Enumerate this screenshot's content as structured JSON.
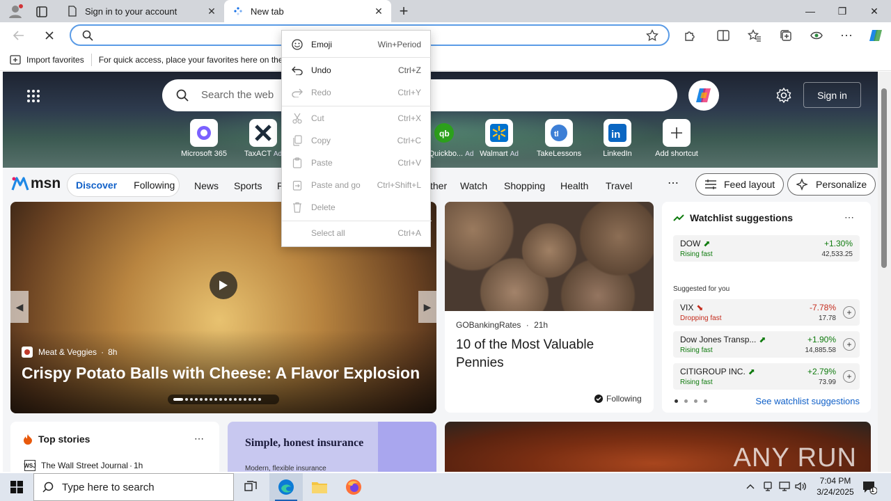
{
  "browser": {
    "tabs": [
      {
        "title": "Sign in to your account",
        "active": false
      },
      {
        "title": "New tab",
        "active": true
      }
    ],
    "address_bar": {
      "value": "",
      "placeholder": ""
    },
    "favorites_bar": {
      "import_label": "Import favorites",
      "hint": "For quick access, place your favorites here on the f"
    },
    "colors": {
      "accent": "#1060c8",
      "address_border": "#5a9be6"
    }
  },
  "newtab": {
    "search_placeholder": "Search the web",
    "sign_in": "Sign in",
    "shortcuts": [
      {
        "label": "Microsoft 365",
        "ad": ""
      },
      {
        "label": "TaxACT",
        "ad": "Ad"
      },
      {
        "label": "Quickbo...",
        "ad": "Ad"
      },
      {
        "label": "Walmart",
        "ad": "Ad"
      },
      {
        "label": "TakeLessons",
        "ad": ""
      },
      {
        "label": "LinkedIn",
        "ad": ""
      },
      {
        "label": "Add shortcut",
        "ad": ""
      }
    ],
    "brand": "msn",
    "feed_tabs": [
      "Discover",
      "Following"
    ],
    "nav_items": [
      "News",
      "Sports",
      "Pl",
      "ther",
      "Watch",
      "Shopping",
      "Health",
      "Travel"
    ],
    "feed_layout": "Feed layout",
    "personalize": "Personalize",
    "feature": {
      "source": "Meat & Veggies",
      "age": "8h",
      "title": "Crispy Potato Balls with Cheese: A Flavor Explosion"
    },
    "story2": {
      "source": "GOBankingRates",
      "age": "21h",
      "title": "10 of the Most Valuable Pennies",
      "following": "Following"
    },
    "watchlist": {
      "title": "Watchlist suggestions",
      "suggested_label": "Suggested for you",
      "see_all": "See watchlist suggestions",
      "items": [
        {
          "name": "DOW",
          "status": "Rising fast",
          "change": "+1.30%",
          "value": "42,533.25",
          "trend": "up"
        },
        {
          "name": "VIX",
          "status": "Dropping fast",
          "change": "-7.78%",
          "value": "17.78",
          "trend": "down"
        },
        {
          "name": "Dow Jones Transp...",
          "status": "Rising fast",
          "change": "+1.90%",
          "value": "14,885.58",
          "trend": "up"
        },
        {
          "name": "CITIGROUP INC.",
          "status": "Rising fast",
          "change": "+2.79%",
          "value": "73.99",
          "trend": "up"
        }
      ]
    },
    "top_stories": {
      "title": "Top stories",
      "first_source": "The Wall Street Journal",
      "first_age": "1h"
    },
    "ad_insurance": {
      "headline": "Simple, honest insurance",
      "sub": "Modern, flexible insurance"
    },
    "watermark": "ANY RUN"
  },
  "context_menu": {
    "items": [
      {
        "label": "Emoji",
        "shortcut": "Win+Period",
        "enabled": true,
        "icon": "emoji-icon"
      },
      {
        "label": "Undo",
        "shortcut": "Ctrl+Z",
        "enabled": true,
        "icon": "undo-icon"
      },
      {
        "label": "Redo",
        "shortcut": "Ctrl+Y",
        "enabled": false,
        "icon": "redo-icon"
      },
      {
        "label": "Cut",
        "shortcut": "Ctrl+X",
        "enabled": false,
        "icon": "cut-icon"
      },
      {
        "label": "Copy",
        "shortcut": "Ctrl+C",
        "enabled": false,
        "icon": "copy-icon"
      },
      {
        "label": "Paste",
        "shortcut": "Ctrl+V",
        "enabled": false,
        "icon": "paste-icon"
      },
      {
        "label": "Paste and go",
        "shortcut": "Ctrl+Shift+L",
        "enabled": false,
        "icon": "paste-go-icon"
      },
      {
        "label": "Delete",
        "shortcut": "",
        "enabled": false,
        "icon": "delete-icon"
      },
      {
        "label": "Select all",
        "shortcut": "Ctrl+A",
        "enabled": false,
        "icon": ""
      }
    ]
  },
  "taskbar": {
    "search_placeholder": "Type here to search",
    "time": "7:04 PM",
    "date": "3/24/2025",
    "notification_count": "1"
  }
}
